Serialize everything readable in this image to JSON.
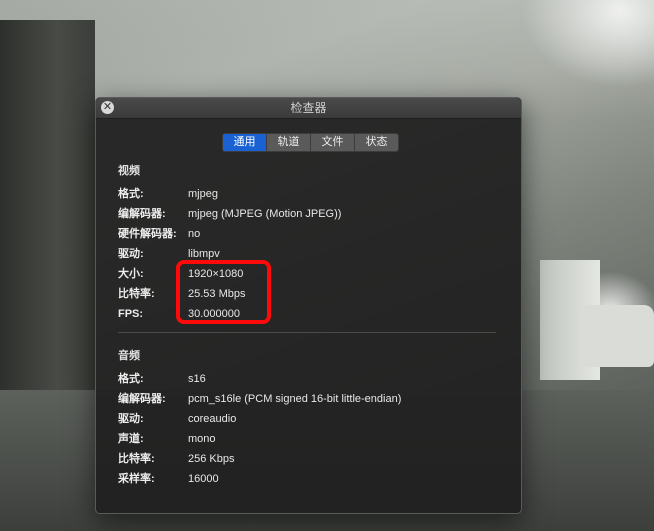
{
  "window": {
    "title": "检查器",
    "close_icon": "close-icon"
  },
  "tabs": [
    {
      "label": "通用",
      "active": true
    },
    {
      "label": "轨道",
      "active": false
    },
    {
      "label": "文件",
      "active": false
    },
    {
      "label": "状态",
      "active": false
    }
  ],
  "video": {
    "section_title": "视频",
    "rows": [
      {
        "label": "格式:",
        "value": "mjpeg"
      },
      {
        "label": "编解码器:",
        "value": "mjpeg (MJPEG (Motion JPEG))"
      },
      {
        "label": "硬件解码器:",
        "value": "no"
      },
      {
        "label": "驱动:",
        "value": "libmpv"
      },
      {
        "label": "大小:",
        "value": "1920×1080"
      },
      {
        "label": "比特率:",
        "value": "25.53 Mbps"
      },
      {
        "label": "FPS:",
        "value": "30.000000"
      }
    ]
  },
  "audio": {
    "section_title": "音频",
    "rows": [
      {
        "label": "格式:",
        "value": "s16"
      },
      {
        "label": "编解码器:",
        "value": "pcm_s16le (PCM signed 16-bit little-endian)"
      },
      {
        "label": "驱动:",
        "value": "coreaudio"
      },
      {
        "label": "声道:",
        "value": "mono"
      },
      {
        "label": "比特率:",
        "value": "256 Kbps"
      },
      {
        "label": "采样率:",
        "value": "16000"
      }
    ]
  },
  "colors": {
    "accent": "#1a62d4",
    "highlight": "#ff0a0a"
  }
}
